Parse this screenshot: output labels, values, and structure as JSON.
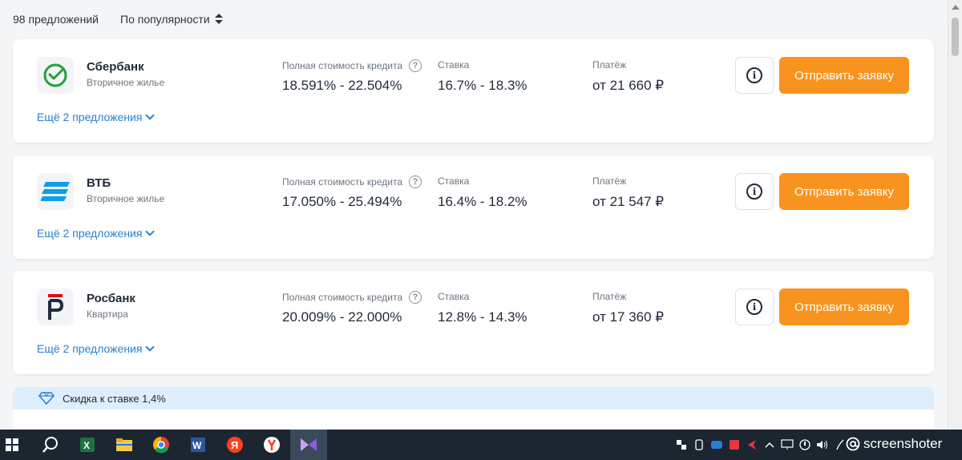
{
  "header": {
    "offers_count": "98 предложений",
    "sort_label": "По популярности"
  },
  "common": {
    "psk_label": "Полная стоимость кредита",
    "rate_label": "Ставка",
    "payment_label": "Платёж",
    "apply_label": "Отправить заявку",
    "more_label": "Ещё 2 предложения",
    "info_glyph": "i",
    "question_glyph": "?"
  },
  "offers": [
    {
      "bank": "Сбербанк",
      "product": "Вторичное жилье",
      "psk": "18.591% - 22.504%",
      "rate": "16.7% - 18.3%",
      "payment": "от 21 660 ₽",
      "brand_color": "#21a038"
    },
    {
      "bank": "ВТБ",
      "product": "Вторичное жилье",
      "psk": "17.050% - 25.494%",
      "rate": "16.4% - 18.2%",
      "payment": "от 21 547 ₽",
      "brand_color": "#0a2896"
    },
    {
      "bank": "Росбанк",
      "product": "Квартира",
      "psk": "20.009% - 22.000%",
      "rate": "12.8% - 14.3%",
      "payment": "от 17 360 ₽",
      "brand_color": "#e30613"
    }
  ],
  "discount": {
    "text": "Скидка к ставке 1,4%"
  },
  "taskbar": {
    "apps": [
      "windows-start",
      "search",
      "excel",
      "file-explorer",
      "chrome",
      "word",
      "yandex",
      "yandex-browser",
      "app"
    ],
    "watermark": "screenshoter"
  },
  "colors": {
    "accent": "#f7931e",
    "link": "#2a7fd4",
    "discount_bg": "#deeefb"
  }
}
